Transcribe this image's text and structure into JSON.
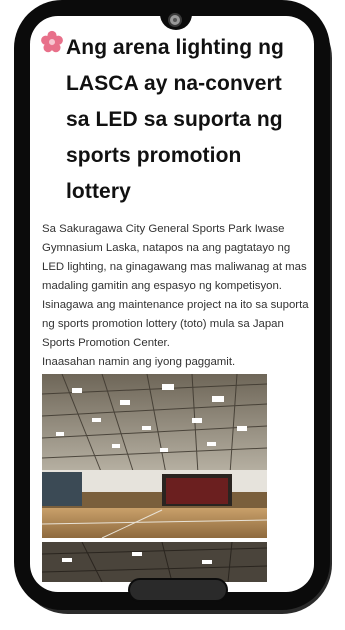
{
  "article": {
    "title": "Ang arena lighting ng LASCA ay na-convert sa LED sa suporta ng sports promotion lottery",
    "paragraph_1": "Sa Sakuragawa City General Sports Park Iwase Gymnasium Laska, natapos na ang pagtatayo ng LED lighting, na ginagawang mas maliwanag at mas madaling gamitin ang espasyo ng kompetisyon.",
    "paragraph_2": "Isinagawa ang maintenance project na ito sa suporta ng sports promotion lottery (toto) mula sa Japan Sports Promotion Center.",
    "paragraph_3": "Inaasahan namin ang iyong paggamit."
  },
  "icons": {
    "title_bullet": "cherry-blossom-icon",
    "title_bullet_color": "#e8708a"
  },
  "colors": {
    "phone_frame": "#0b0b0b",
    "title_text": "#111111",
    "body_text": "#333333"
  }
}
